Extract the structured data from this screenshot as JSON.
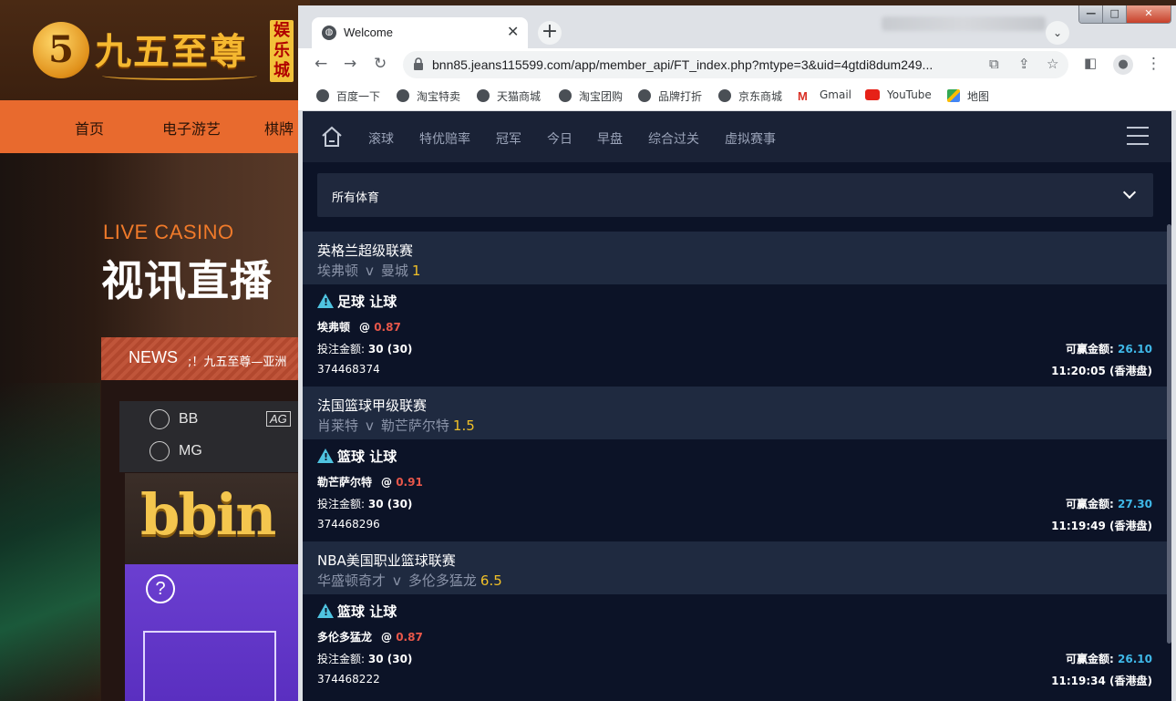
{
  "background_site": {
    "logo_glyph": "5",
    "logo_text": "九五至尊",
    "logo_tag": "娱乐城",
    "nav": [
      "首页",
      "电子游艺",
      "棋牌"
    ],
    "live_casino": "LIVE CASINO",
    "hero_title": "视讯直播",
    "news_label": "NEWS",
    "news_text": ";！九五至尊—亚洲",
    "tabs": [
      "BB",
      "MG"
    ],
    "tab_ag": "AG",
    "bbin_logo": "bbin",
    "help_glyph": "?"
  },
  "browser": {
    "tab_title": "Welcome",
    "url": "bnn85.jeans115599.com/app/member_api/FT_index.php?mtype=3&uid=4gtdi8dum249...",
    "bookmarks": [
      "百度一下",
      "淘宝特卖",
      "天猫商城",
      "淘宝团购",
      "品牌打折",
      "京东商城",
      "Gmail",
      "YouTube",
      "地图"
    ]
  },
  "app": {
    "nav": [
      "滚球",
      "特优赔率",
      "冠军",
      "今日",
      "早盘",
      "综合过关",
      "虚拟赛事"
    ],
    "sport_select": "所有体育",
    "labels": {
      "stake": "投注金额:",
      "win": "可赢金额:",
      "at": "@",
      "v": "v"
    },
    "matches": [
      {
        "league": "英格兰超级联赛",
        "home": "埃弗顿",
        "away": "曼城",
        "handicap": "1",
        "bet_type": "足球 让球",
        "pick": "埃弗顿",
        "odds": "0.87",
        "stake": "30 (30)",
        "bet_id": "374468374",
        "win": "26.10",
        "time": "11:20:05 (香港盘)"
      },
      {
        "league": "法国篮球甲级联赛",
        "home": "肖莱特",
        "away": "勒芒萨尔特",
        "handicap": "1.5",
        "bet_type": "篮球 让球",
        "pick": "勒芒萨尔特",
        "odds": "0.91",
        "stake": "30 (30)",
        "bet_id": "374468296",
        "win": "27.30",
        "time": "11:19:49 (香港盘)"
      },
      {
        "league": "NBA美国职业篮球联赛",
        "home": "华盛顿奇才",
        "away": "多伦多猛龙",
        "handicap": "6.5",
        "bet_type": "篮球 让球",
        "pick": "多伦多猛龙",
        "odds": "0.87",
        "stake": "30 (30)",
        "bet_id": "374468222",
        "win": "26.10",
        "time": "11:19:34 (香港盘)"
      }
    ]
  },
  "colors": {
    "app_bg": "#0c1327",
    "header_bg": "#1f2a40",
    "odds": "#e8574a",
    "win_amount": "#3fb8e8",
    "handicap": "#f0c028"
  }
}
